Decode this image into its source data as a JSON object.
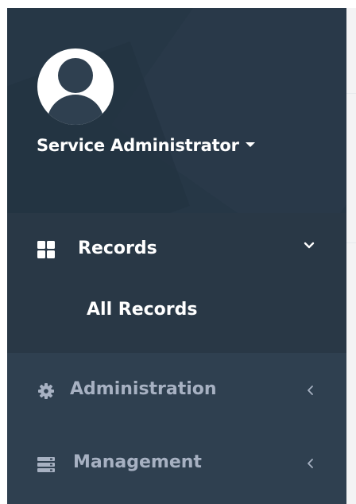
{
  "profile": {
    "name": "Service Administrator",
    "avatar_icon": "user-avatar-icon",
    "dropdown_icon": "caret-down-icon"
  },
  "nav": {
    "records": {
      "label": "Records",
      "icon": "th-large-icon",
      "state_icon": "chevron-down-icon",
      "expanded": true,
      "children": [
        {
          "label": "All Records"
        }
      ]
    },
    "administration": {
      "label": "Administration",
      "icon": "gear-icon",
      "state_icon": "chevron-left-icon"
    },
    "management": {
      "label": "Management",
      "icon": "server-icon",
      "state_icon": "chevron-left-icon"
    }
  },
  "colors": {
    "sidebar_bg": "#2f4050",
    "active_section_bg": "#293846",
    "active_text": "#ffffff",
    "inactive_text": "#a7b1c2"
  }
}
